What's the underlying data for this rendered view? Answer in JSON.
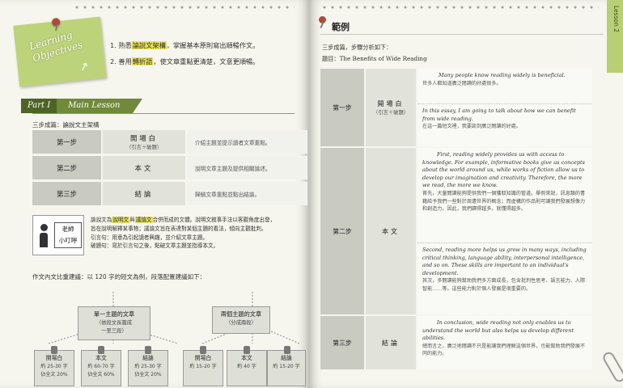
{
  "objectives": {
    "title": "Learning Objectives",
    "items": [
      {
        "num": "1.",
        "pre": "熟悉",
        "hl": "論說文架構",
        "post": "，掌握基本原則寫出順暢作文。"
      },
      {
        "num": "2.",
        "pre": "善用",
        "hl": "轉折語",
        "post": "，使文章重點更清楚，文意更順暢。"
      }
    ]
  },
  "part": {
    "label": "Part I",
    "title": "Main Lesson"
  },
  "structure": {
    "title": "三步成篇：論說文主架構",
    "rows": [
      {
        "step": "第一步",
        "part": "開場白",
        "sub": "（引言＋破題）",
        "desc": "介紹主題並提示讀者文章重點。"
      },
      {
        "step": "第二步",
        "part": "本文",
        "sub": "",
        "desc": "說明文章主題及提供相關論述。"
      },
      {
        "step": "第三步",
        "part": "結論",
        "sub": "",
        "desc": "歸納文章重點並點出結論。"
      }
    ]
  },
  "tip": {
    "label_line1": "老師",
    "label_line2": "小叮嚀",
    "line1_a": "論說文為",
    "line1_hl1": "說明文",
    "line1_b": "與",
    "line1_hl2": "議論文",
    "line1_c": "合併而成的文體。說明文敘事手法以客觀角度出發，",
    "line2": "旨在說明解釋某事物；議論文旨在表達對某個主題的看法，傾向主觀批判。",
    "line3": "引言句：用意為引起讀者興趣，並介紹文章主題。",
    "line4": "破題句：寫於引言句之後，點破文章主題並指導本文。"
  },
  "length_section": {
    "title": "作文內文比重建議：以 120 字的短文為例，段落配置建議如下：",
    "single": {
      "title": "單一主題的文章",
      "sub1": "（依段文長篇成",
      "sub2": "一至三段）",
      "parts": [
        {
          "name": "開場白",
          "l1": "約 25-30 字",
          "l2": "佔全文 20%"
        },
        {
          "name": "本文",
          "l1": "約 60-70 字",
          "l2": "佔全文 60%"
        },
        {
          "name": "結論",
          "l1": "約 25-30 字",
          "l2": "佔全文 20%"
        }
      ]
    },
    "double": {
      "title": "兩個主題的文章",
      "sub1": "（分成兩段）",
      "parts": [
        {
          "name": "開場白",
          "l1": "約 15-20 字",
          "l2": ""
        },
        {
          "name": "本文",
          "l1": "約 40 字",
          "l2": ""
        },
        {
          "name": "結論",
          "l1": "約 15-20 字",
          "l2": ""
        }
      ]
    }
  },
  "lesson_tab": "Lesson 2",
  "example": {
    "title": "範例",
    "intro": "三步成篇，步驟分析如下：",
    "topic_label": "題目：",
    "topic": "The Benefits of Wide Reading",
    "rows": [
      {
        "step": "第一步",
        "part": "開場白",
        "sub": "（引言＋破題）",
        "paras": [
          {
            "en": "Many people know reading widely is beneficial.",
            "zh": "世多人都知道廣泛閱讀的好處很多。"
          },
          {
            "en": "In this essay, I am going to talk about how we can benefit from wide reading.",
            "zh": "在這一篇短文裡，我要談到廣泛閱讀的好處。"
          }
        ]
      },
      {
        "step": "第二步",
        "part": "本文",
        "sub": "",
        "paras": [
          {
            "en": "First, reading widely provides us with access to knowledge. For example, informative books give us concepts about the world around us, while works of fiction allow us to develop our imagination and creativity. Therefore, the more we read, the more we know.",
            "zh": "首先，大量閱讀能夠提供我們一個獲取知識的管道。舉例來說，訊息類的書籍給予我們一些對於周遭世界的概念；而虛構的作品則可讓我們發展想像力和創造力。因此，我們讀得越多，就懂得越多。"
          },
          {
            "en": "Second, reading more helps us grow in many ways, including critical thinking, language ability, interpersonal intelligence, and so on. These skills are important to an individual's development.",
            "zh": "其次，多閱讀能夠幫助我們多方面成長，包含批判性思考、語言能力、人際智能……等。這些能力對於個人發展是很重要的。"
          }
        ]
      },
      {
        "step": "第三步",
        "part": "結論",
        "sub": "",
        "paras": [
          {
            "en": "In conclusion, wide reading not only enables us to understand the world but also helps us develop different abilities.",
            "zh": "總而言之，廣泛地閱讀不只是能讓我們理解這個世界，也能幫助我們發展不同的能力。"
          }
        ]
      }
    ]
  }
}
